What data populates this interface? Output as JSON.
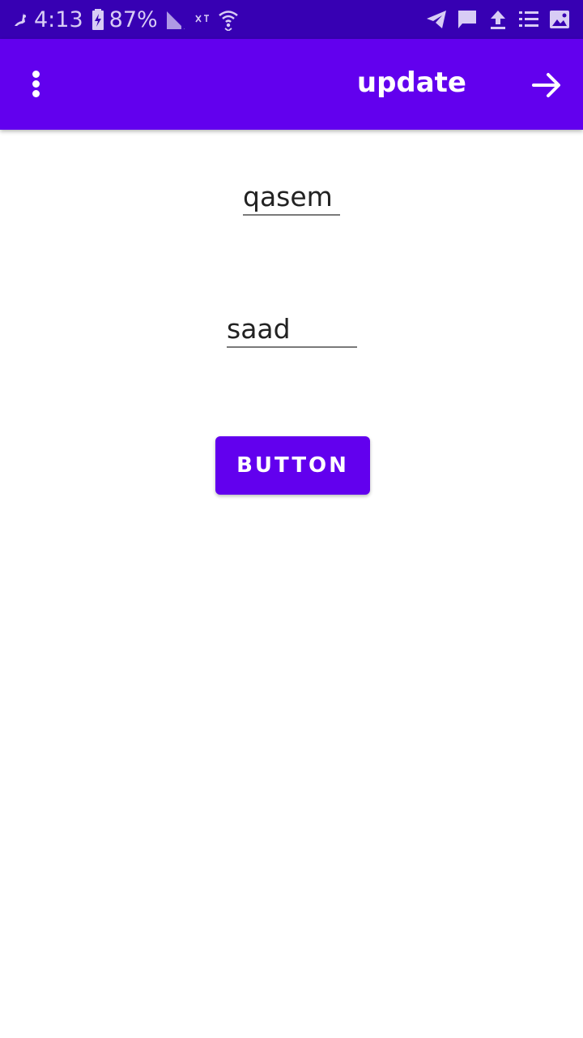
{
  "status_bar": {
    "time": "4:13",
    "battery": "87%",
    "left_icons": [
      "app-notification-icon",
      "battery-charging-icon",
      "signal-icon",
      "no-signal-icon",
      "wifi-icon"
    ],
    "right_icons": [
      "telegram-icon",
      "message-icon",
      "upload-icon",
      "list-icon",
      "image-icon"
    ]
  },
  "app_bar": {
    "title": "update",
    "background": "#6200ee",
    "menu_icon": "more-vert-icon",
    "forward_icon": "arrow-forward-icon"
  },
  "form": {
    "field1_value": "qasem",
    "field2_value": "saad",
    "button_label": "BUTTON"
  },
  "colors": {
    "status_bar": "#3700b3",
    "accent": "#6200ee"
  }
}
